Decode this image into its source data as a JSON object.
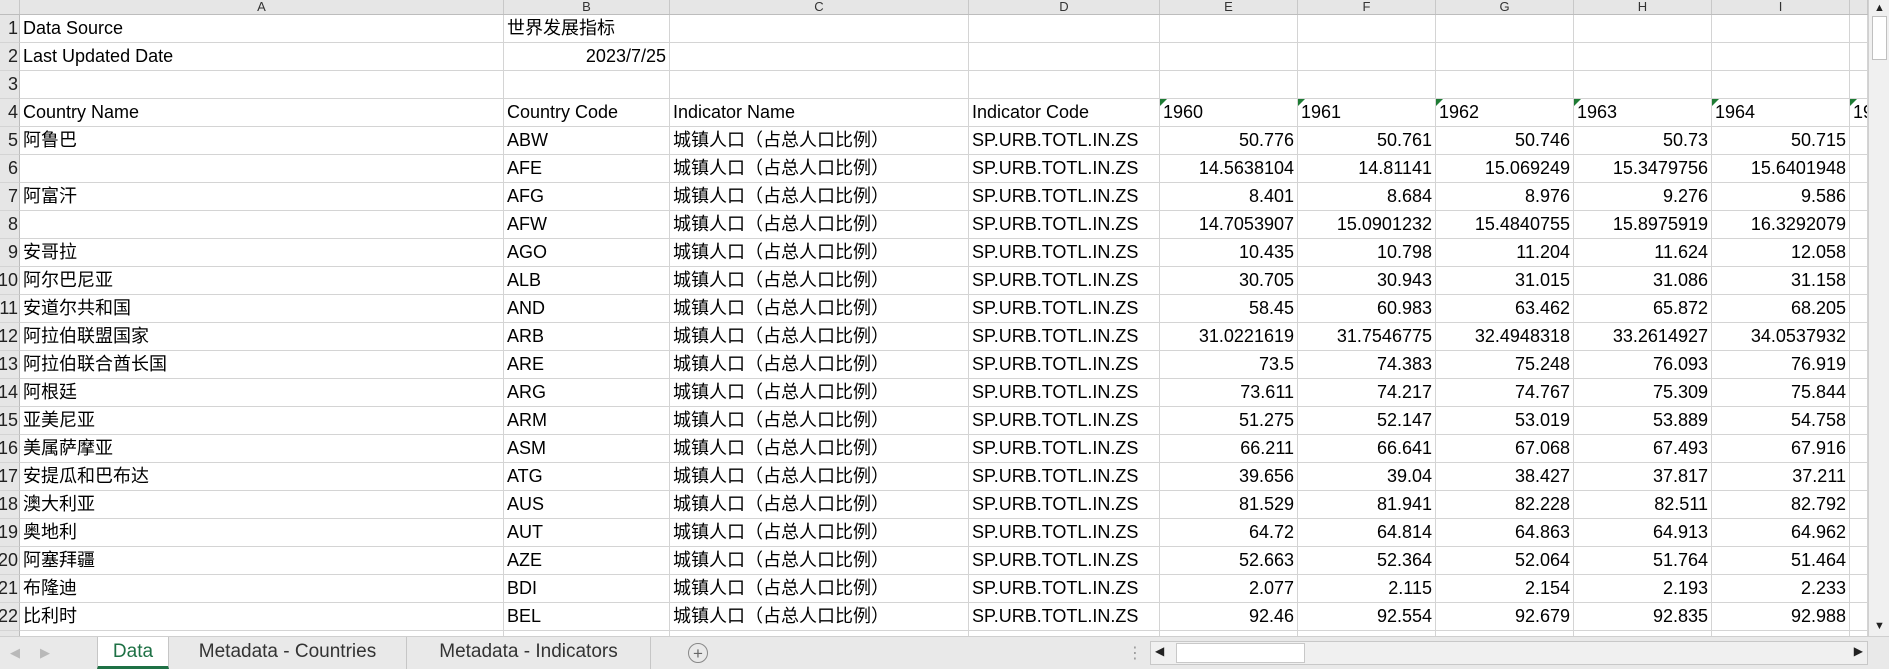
{
  "columns": [
    "A",
    "B",
    "C",
    "D",
    "E",
    "F",
    "G",
    "H",
    "I"
  ],
  "meta": {
    "data_source_label": "Data Source",
    "data_source_value": "世界发展指标",
    "last_updated_label": "Last Updated Date",
    "last_updated_value": "2023/7/25"
  },
  "headers": {
    "country_name": "Country Name",
    "country_code": "Country Code",
    "indicator_name": "Indicator Name",
    "indicator_code": "Indicator Code",
    "years": [
      "1960",
      "1961",
      "1962",
      "1963",
      "1964"
    ],
    "partial_year": "19"
  },
  "rows": [
    {
      "n": "5",
      "name": "阿鲁巴",
      "code": "ABW",
      "ind": "城镇人口（占总人口比例）",
      "icode": "SP.URB.TOTL.IN.ZS",
      "v": [
        "50.776",
        "50.761",
        "50.746",
        "50.73",
        "50.715"
      ]
    },
    {
      "n": "6",
      "name": "",
      "code": "AFE",
      "ind": "城镇人口（占总人口比例）",
      "icode": "SP.URB.TOTL.IN.ZS",
      "v": [
        "14.5638104",
        "14.81141",
        "15.069249",
        "15.3479756",
        "15.6401948"
      ]
    },
    {
      "n": "7",
      "name": "阿富汗",
      "code": "AFG",
      "ind": "城镇人口（占总人口比例）",
      "icode": "SP.URB.TOTL.IN.ZS",
      "v": [
        "8.401",
        "8.684",
        "8.976",
        "9.276",
        "9.586"
      ]
    },
    {
      "n": "8",
      "name": "",
      "code": "AFW",
      "ind": "城镇人口（占总人口比例）",
      "icode": "SP.URB.TOTL.IN.ZS",
      "v": [
        "14.7053907",
        "15.0901232",
        "15.4840755",
        "15.8975919",
        "16.3292079"
      ]
    },
    {
      "n": "9",
      "name": "安哥拉",
      "code": "AGO",
      "ind": "城镇人口（占总人口比例）",
      "icode": "SP.URB.TOTL.IN.ZS",
      "v": [
        "10.435",
        "10.798",
        "11.204",
        "11.624",
        "12.058"
      ]
    },
    {
      "n": "10",
      "name": "阿尔巴尼亚",
      "code": "ALB",
      "ind": "城镇人口（占总人口比例）",
      "icode": "SP.URB.TOTL.IN.ZS",
      "v": [
        "30.705",
        "30.943",
        "31.015",
        "31.086",
        "31.158"
      ]
    },
    {
      "n": "11",
      "name": "安道尔共和国",
      "code": "AND",
      "ind": "城镇人口（占总人口比例）",
      "icode": "SP.URB.TOTL.IN.ZS",
      "v": [
        "58.45",
        "60.983",
        "63.462",
        "65.872",
        "68.205"
      ]
    },
    {
      "n": "12",
      "name": "阿拉伯联盟国家",
      "code": "ARB",
      "ind": "城镇人口（占总人口比例）",
      "icode": "SP.URB.TOTL.IN.ZS",
      "v": [
        "31.0221619",
        "31.7546775",
        "32.4948318",
        "33.2614927",
        "34.0537932"
      ]
    },
    {
      "n": "13",
      "name": "阿拉伯联合酋长国",
      "code": "ARE",
      "ind": "城镇人口（占总人口比例）",
      "icode": "SP.URB.TOTL.IN.ZS",
      "v": [
        "73.5",
        "74.383",
        "75.248",
        "76.093",
        "76.919"
      ]
    },
    {
      "n": "14",
      "name": "阿根廷",
      "code": "ARG",
      "ind": "城镇人口（占总人口比例）",
      "icode": "SP.URB.TOTL.IN.ZS",
      "v": [
        "73.611",
        "74.217",
        "74.767",
        "75.309",
        "75.844"
      ]
    },
    {
      "n": "15",
      "name": "亚美尼亚",
      "code": "ARM",
      "ind": "城镇人口（占总人口比例）",
      "icode": "SP.URB.TOTL.IN.ZS",
      "v": [
        "51.275",
        "52.147",
        "53.019",
        "53.889",
        "54.758"
      ]
    },
    {
      "n": "16",
      "name": "美属萨摩亚",
      "code": "ASM",
      "ind": "城镇人口（占总人口比例）",
      "icode": "SP.URB.TOTL.IN.ZS",
      "v": [
        "66.211",
        "66.641",
        "67.068",
        "67.493",
        "67.916"
      ]
    },
    {
      "n": "17",
      "name": "安提瓜和巴布达",
      "code": "ATG",
      "ind": "城镇人口（占总人口比例）",
      "icode": "SP.URB.TOTL.IN.ZS",
      "v": [
        "39.656",
        "39.04",
        "38.427",
        "37.817",
        "37.211"
      ]
    },
    {
      "n": "18",
      "name": "澳大利亚",
      "code": "AUS",
      "ind": "城镇人口（占总人口比例）",
      "icode": "SP.URB.TOTL.IN.ZS",
      "v": [
        "81.529",
        "81.941",
        "82.228",
        "82.511",
        "82.792"
      ]
    },
    {
      "n": "19",
      "name": "奥地利",
      "code": "AUT",
      "ind": "城镇人口（占总人口比例）",
      "icode": "SP.URB.TOTL.IN.ZS",
      "v": [
        "64.72",
        "64.814",
        "64.863",
        "64.913",
        "64.962"
      ]
    },
    {
      "n": "20",
      "name": "阿塞拜疆",
      "code": "AZE",
      "ind": "城镇人口（占总人口比例）",
      "icode": "SP.URB.TOTL.IN.ZS",
      "v": [
        "52.663",
        "52.364",
        "52.064",
        "51.764",
        "51.464"
      ]
    },
    {
      "n": "21",
      "name": "布隆迪",
      "code": "BDI",
      "ind": "城镇人口（占总人口比例）",
      "icode": "SP.URB.TOTL.IN.ZS",
      "v": [
        "2.077",
        "2.115",
        "2.154",
        "2.193",
        "2.233"
      ]
    },
    {
      "n": "22",
      "name": "比利时",
      "code": "BEL",
      "ind": "城镇人口（占总人口比例）",
      "icode": "SP.URB.TOTL.IN.ZS",
      "v": [
        "92.46",
        "92.554",
        "92.679",
        "92.835",
        "92.988"
      ]
    }
  ],
  "sheet_tabs": [
    "Data",
    "Metadata - Countries",
    "Metadata - Indicators"
  ],
  "active_tab": "Data",
  "colors": {
    "accent": "#1e7145",
    "error_triangle": "#1e7b34",
    "grid_line": "#d4d4d4",
    "header_bg": "#e6e6e6"
  }
}
